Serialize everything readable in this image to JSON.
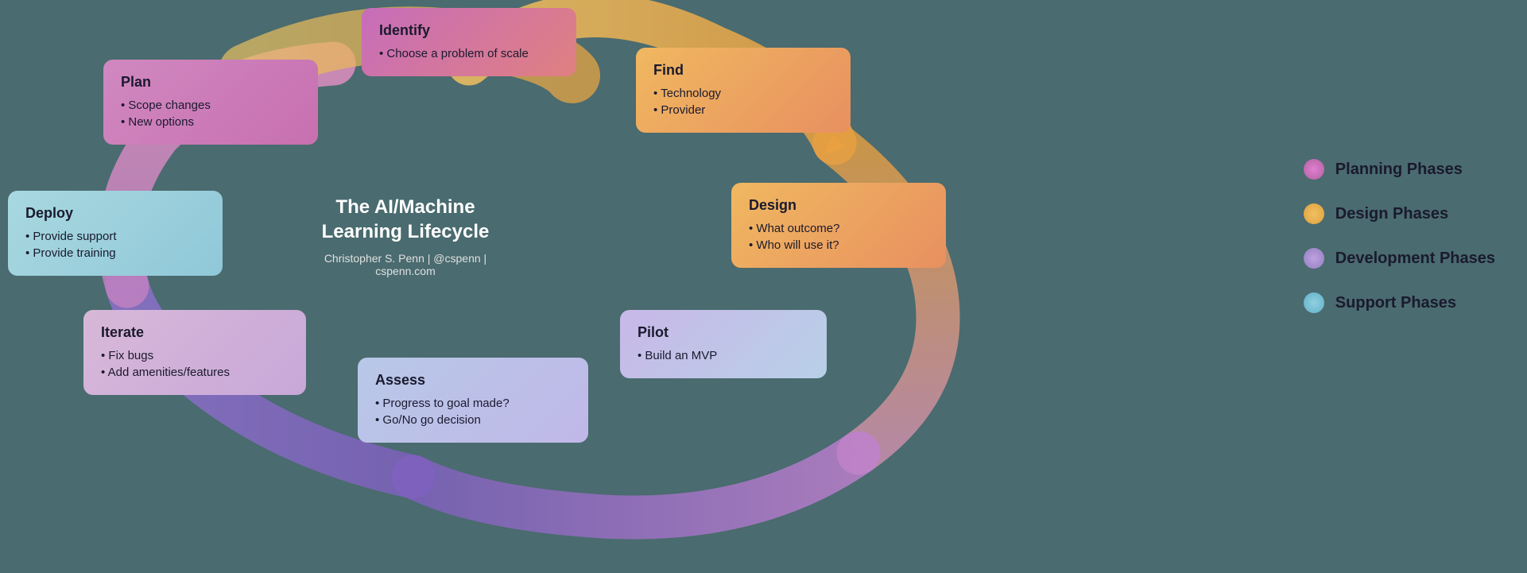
{
  "cards": {
    "identify": {
      "title": "Identify",
      "items": [
        "Choose a problem of scale"
      ]
    },
    "find": {
      "title": "Find",
      "items": [
        "Technology",
        "Provider"
      ]
    },
    "design": {
      "title": "Design",
      "items": [
        "What outcome?",
        "Who will use it?"
      ]
    },
    "pilot": {
      "title": "Pilot",
      "items": [
        "Build an MVP"
      ]
    },
    "assess": {
      "title": "Assess",
      "items": [
        "Progress to goal made?",
        "Go/No go decision"
      ]
    },
    "iterate": {
      "title": "Iterate",
      "items": [
        "Fix bugs",
        "Add amenities/features"
      ]
    },
    "deploy": {
      "title": "Deploy",
      "items": [
        "Provide support",
        "Provide training"
      ]
    },
    "plan": {
      "title": "Plan",
      "items": [
        "Scope changes",
        "New options"
      ]
    }
  },
  "center": {
    "title": "The AI/Machine\nLearning Lifecycle",
    "subtitle": "Christopher S. Penn | @cspenn | cspenn.com"
  },
  "legend": {
    "planning": {
      "label": "Planning Phases"
    },
    "design": {
      "label": "Design Phases"
    },
    "development": {
      "label": "Development Phases"
    },
    "support": {
      "label": "Support Phases"
    }
  }
}
